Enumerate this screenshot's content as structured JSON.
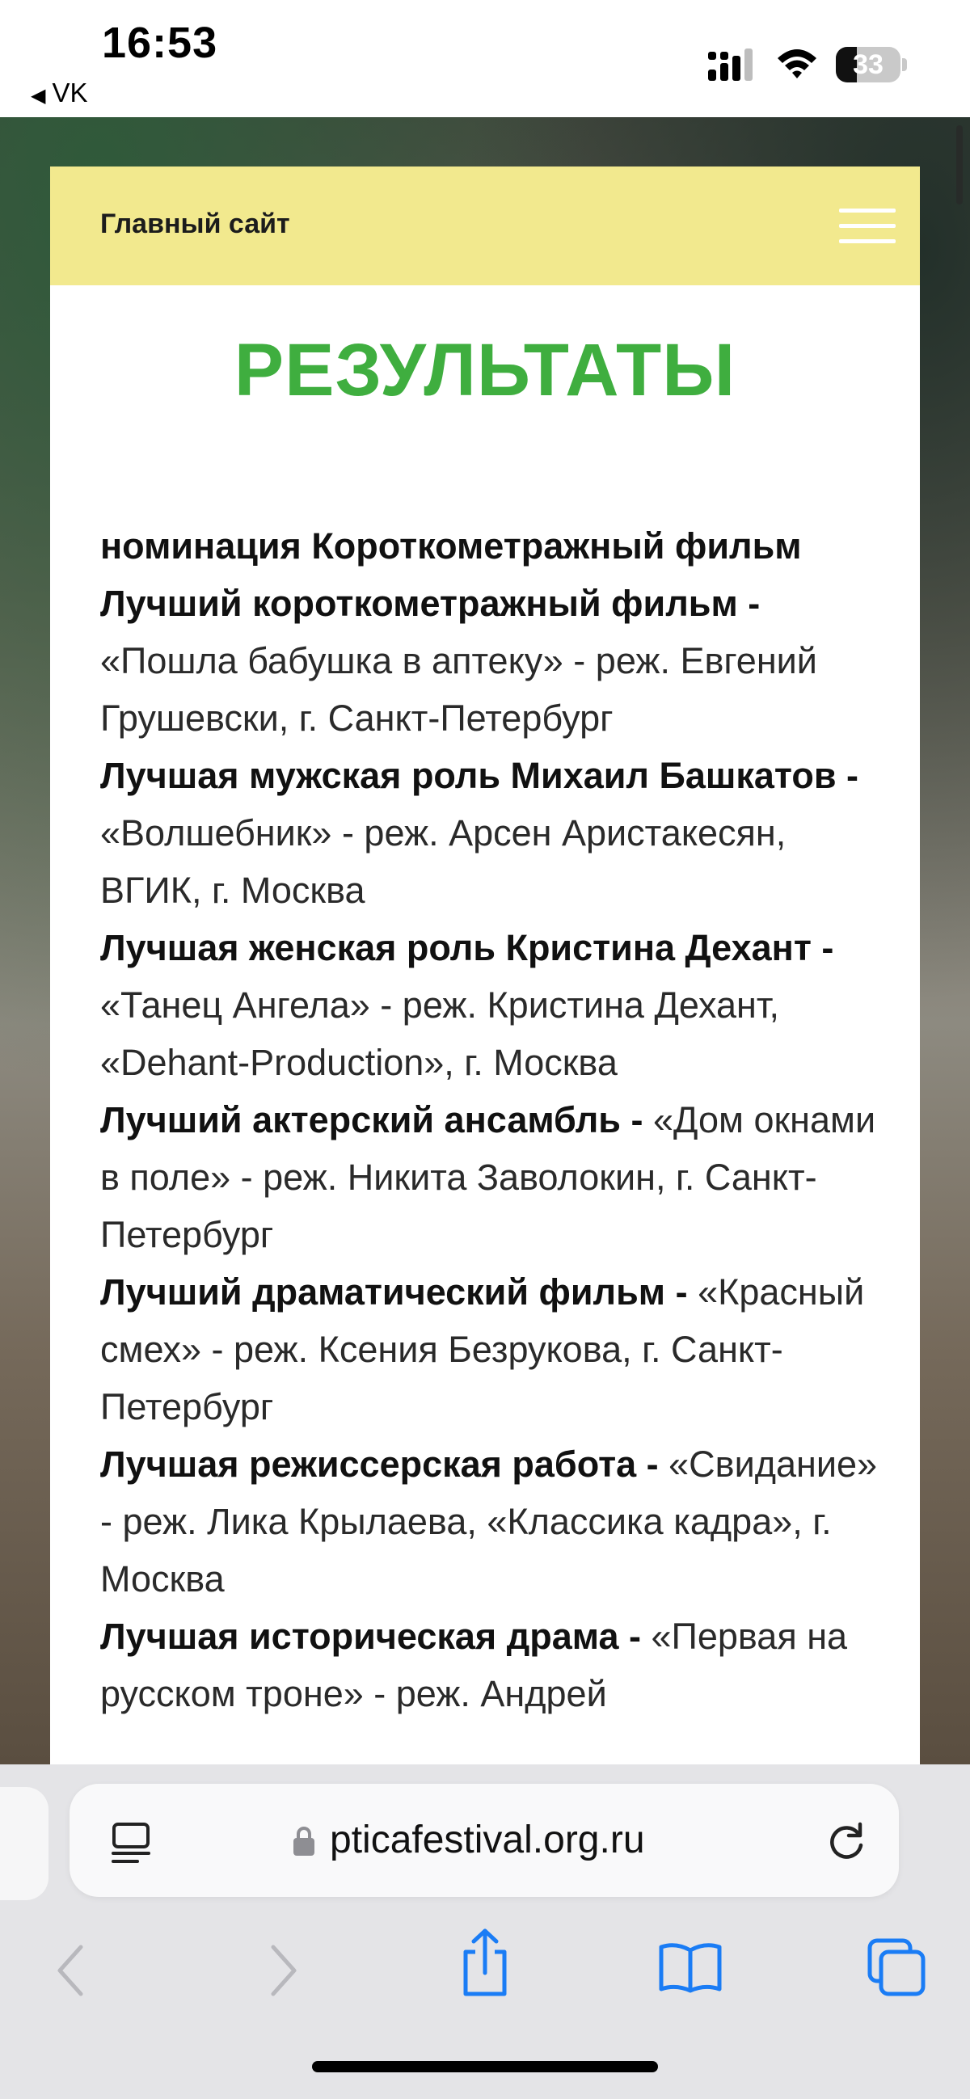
{
  "status_bar": {
    "time": "16:53",
    "back_app": "VK",
    "battery_percent": "33",
    "battery_level": 0.33
  },
  "site": {
    "header_title": "Главный сайт",
    "menu_icon": "hamburger-menu-icon",
    "page_title": "РЕЗУЛЬТАТЫ"
  },
  "results": [
    {
      "bold": "номинация Короткометражный фильм",
      "text": ""
    },
    {
      "bold": "Лучший короткометражный фильм - ",
      "text": "«Пошла бабушка в аптеку» - реж. Евгений Грушевски, г. Санкт-Петербург"
    },
    {
      "bold": "Лучшая мужская роль Михаил Башкатов - ",
      "text": "«Волшебник» - реж. Арсен Аристакесян, ВГИК, г. Москва"
    },
    {
      "bold": "Лучшая женская роль Кристина Дехант - ",
      "text": "«Танец Ангела» - реж. Кристина Дехант, «Dehant-Production», г. Москва"
    },
    {
      "bold": "Лучший актерский ансамбль - ",
      "text": "«Дом окнами в поле» - реж. Никита Заволокин, г. Санкт-Петербург"
    },
    {
      "bold": "Лучший драматический фильм - ",
      "text": "«Красный смех» - реж. Ксения Безрукова, г. Санкт-Петербург"
    },
    {
      "bold": "Лучшая режиссерская работа - ",
      "text": "«Свидание» - реж. Лика Крылаева, «Классика кадра», г. Москва"
    },
    {
      "bold": "Лучшая историческая драма - ",
      "text": "«Первая на русском троне» - реж. Андрей"
    }
  ],
  "browser": {
    "url": "pticafestival.org.ru",
    "icons": [
      "reader-mode-icon",
      "lock-icon",
      "reload-icon",
      "back-arrow-icon",
      "forward-arrow-icon",
      "share-icon",
      "bookmarks-icon",
      "tabs-icon"
    ],
    "accent_color": "#1a7cf5",
    "disabled_color": "#b8b8bd"
  }
}
